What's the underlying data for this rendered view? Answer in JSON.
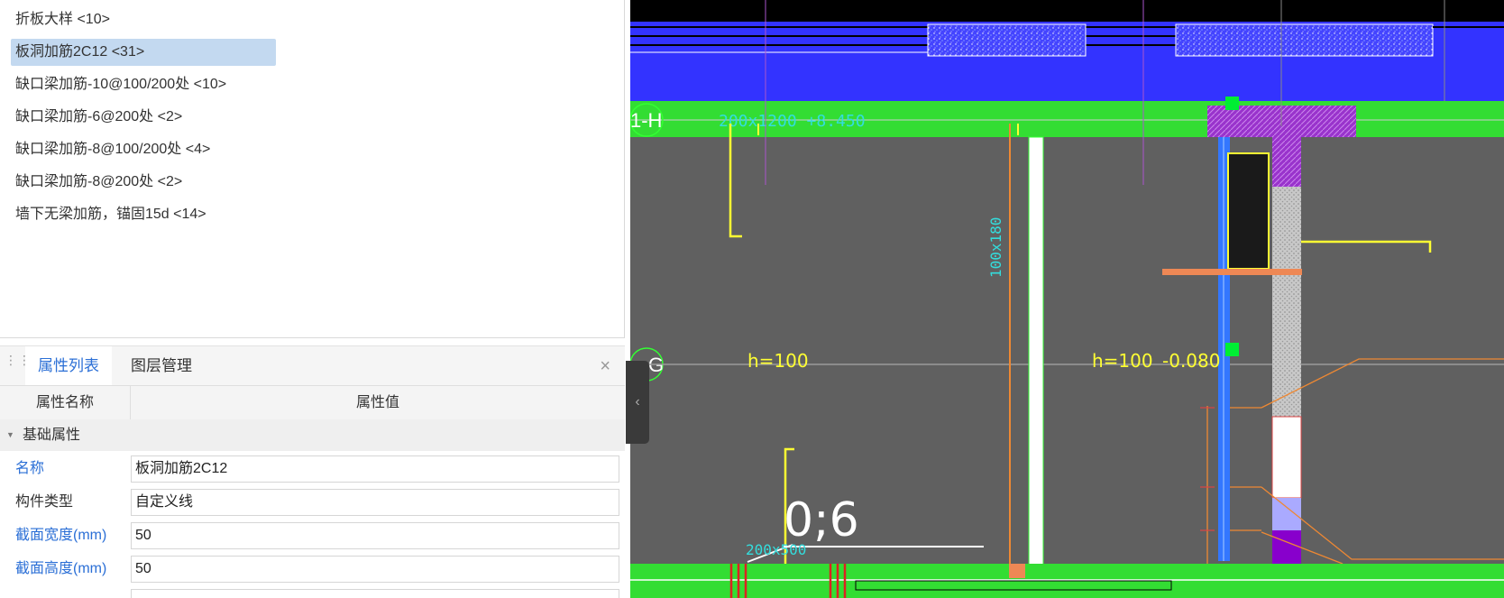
{
  "component_list": {
    "items": [
      {
        "label": "折板大样 <10>",
        "selected": false
      },
      {
        "label": "板洞加筋2C12 <31>",
        "selected": true
      },
      {
        "label": "缺口梁加筋-10@100/200处 <10>",
        "selected": false
      },
      {
        "label": "缺口梁加筋-6@200处 <2>",
        "selected": false
      },
      {
        "label": "缺口梁加筋-8@100/200处 <4>",
        "selected": false
      },
      {
        "label": "缺口梁加筋-8@200处 <2>",
        "selected": false
      },
      {
        "label": "墙下无梁加筋，锚固15d <14>",
        "selected": false
      }
    ]
  },
  "properties_panel": {
    "tabs": [
      {
        "label": "属性列表",
        "active": true
      },
      {
        "label": "图层管理",
        "active": false
      }
    ],
    "close_glyph": "×",
    "header": {
      "name_col": "属性名称",
      "value_col": "属性值"
    },
    "group_label": "基础属性",
    "rows": [
      {
        "label": "名称",
        "value": "板洞加筋2C12",
        "label_color": "blue"
      },
      {
        "label": "构件类型",
        "value": "自定义线",
        "label_color": "black"
      },
      {
        "label": "截面宽度(mm)",
        "value": "50",
        "label_color": "blue"
      },
      {
        "label": "截面高度(mm)",
        "value": "50",
        "label_color": "blue"
      }
    ]
  },
  "collapse_handle": {
    "glyph": "‹"
  },
  "drawing": {
    "axis_labels": [
      "1-H",
      "G"
    ],
    "annotations": {
      "beam_top": "200x1200 +8.450",
      "section_vertical": "100x180",
      "slab_left": "h=100",
      "slab_right": "h=100",
      "elevation": "-0.080",
      "large_label": "0;6",
      "beam_bottom": "200x500"
    },
    "colors": {
      "background": "#606060",
      "wall_blue": "#3333ff",
      "beam_green": "#33dd33",
      "yellow": "#ffff33",
      "cyan": "#33dddd",
      "orange": "#ee8833",
      "purple": "#aa33cc"
    }
  }
}
